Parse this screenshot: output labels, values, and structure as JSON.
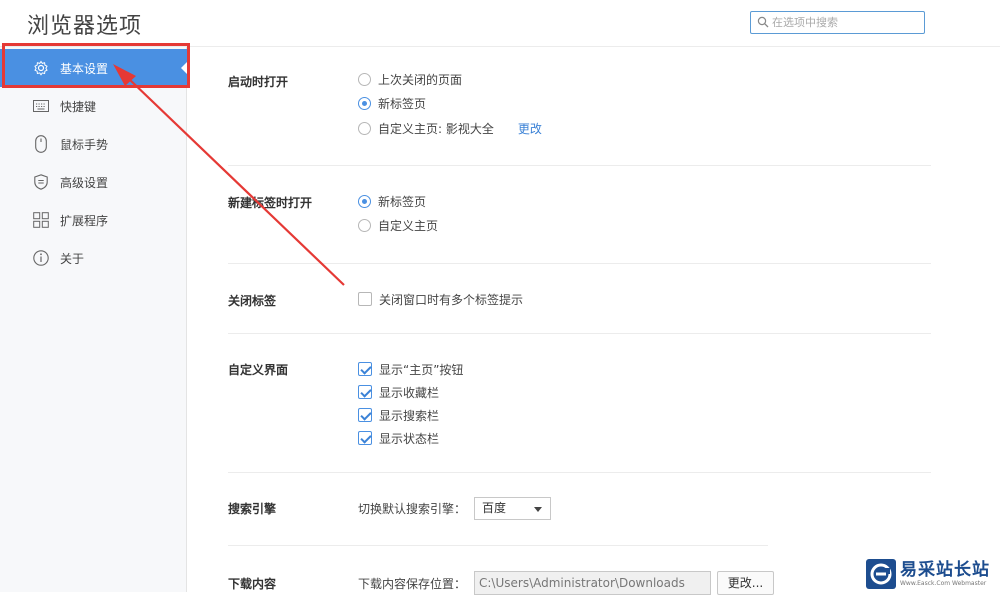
{
  "header": {
    "title": "浏览器选项",
    "search_placeholder": "在选项中搜索"
  },
  "sidebar": {
    "items": [
      {
        "label": "基本设置",
        "icon": "gear-icon",
        "active": true
      },
      {
        "label": "快捷键",
        "icon": "keyboard-icon",
        "active": false
      },
      {
        "label": "鼠标手势",
        "icon": "mouse-icon",
        "active": false
      },
      {
        "label": "高级设置",
        "icon": "shield-icon",
        "active": false
      },
      {
        "label": "扩展程序",
        "icon": "extensions-icon",
        "active": false
      },
      {
        "label": "关于",
        "icon": "info-icon",
        "active": false
      }
    ]
  },
  "sections": {
    "startup": {
      "label": "启动时打开",
      "options": [
        "上次关闭的页面",
        "新标签页",
        "自定义主页: 影视大全"
      ],
      "selected": "新标签页",
      "change_link": "更改"
    },
    "newtab": {
      "label": "新建标签时打开",
      "options": [
        "新标签页",
        "自定义主页"
      ],
      "selected": "新标签页"
    },
    "closetab": {
      "label": "关闭标签",
      "checkbox": "关闭窗口时有多个标签提示",
      "checked": false
    },
    "ui": {
      "label": "自定义界面",
      "checkboxes": [
        "显示“主页”按钮",
        "显示收藏栏",
        "显示搜索栏",
        "显示状态栏"
      ],
      "checked": [
        true,
        true,
        true,
        true
      ]
    },
    "search": {
      "label": "搜索引擎",
      "prompt": "切换默认搜索引擎：",
      "selected": "百度"
    },
    "download": {
      "label": "下载内容",
      "prompt": "下载内容保存位置：",
      "path": "C:\\Users\\Administrator\\Downloads",
      "change_button": "更改..."
    }
  },
  "watermark": {
    "brand": "易采站长站",
    "sub": "Www.Easck.Com Webmaster"
  },
  "colors": {
    "accent": "#4a90e2",
    "annotation": "#e53935"
  }
}
